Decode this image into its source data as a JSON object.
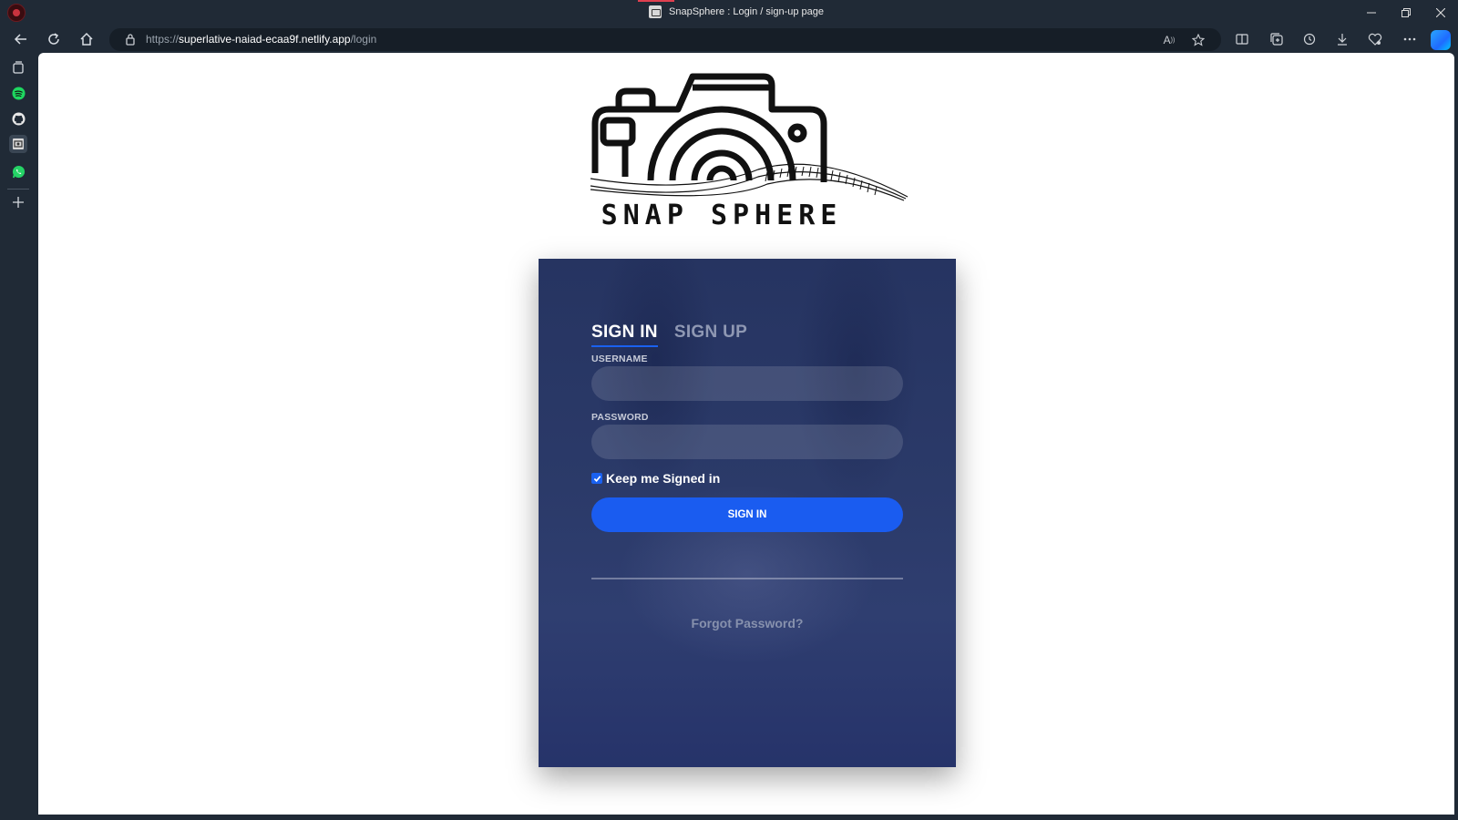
{
  "window": {
    "title": "SnapSphere : Login / sign-up page"
  },
  "address_bar": {
    "url_protocol": "https://",
    "url_host": "superlative-naiad-ecaa9f.netlify.app",
    "url_path": "/login"
  },
  "logo": {
    "text": "SNAP SPHERE"
  },
  "form": {
    "tabs": [
      {
        "label": "SIGN IN"
      },
      {
        "label": "SIGN UP"
      }
    ],
    "username_label": "USERNAME",
    "password_label": "PASSWORD",
    "username_value": "",
    "password_value": "",
    "keep_signed_in_label": "Keep me Signed in",
    "keep_signed_in_checked": true,
    "submit_label": "SIGN IN",
    "forgot_label": "Forgot Password?"
  },
  "colors": {
    "accent": "#1a5cf0",
    "card_bg": "#2b3a69",
    "browser_chrome": "#202a36",
    "spotify": "#1ed760",
    "whatsapp": "#25d366"
  },
  "sidebar_icons": [
    "tabs-icon",
    "spotify-icon",
    "github-icon",
    "snapsphere-tab-icon",
    "whatsapp-icon",
    "add-icon"
  ]
}
